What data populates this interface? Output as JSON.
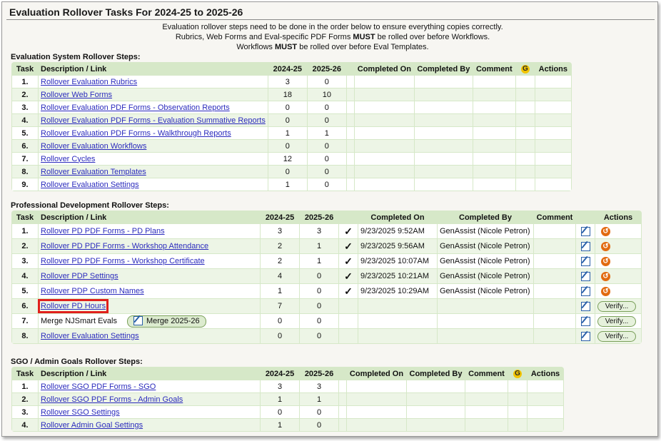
{
  "title": "Evaluation Rollover Tasks For 2024-25 to 2025-26",
  "intro": {
    "line1": "Evaluation rollover steps need to be done in the order below to ensure everything copies correctly.",
    "line2a": "Rubrics, Web Forms and Eval-specific PDF Forms ",
    "line2b": "MUST",
    "line2c": " be rolled over before Workflows.",
    "line3a": "Workflows ",
    "line3b": "MUST",
    "line3c": " be rolled over before Eval Templates."
  },
  "headers": {
    "task": "Task",
    "desc": "Description / Link",
    "y1": "2024-25",
    "y2": "2025-26",
    "completed_on": "Completed On",
    "completed_by": "Completed By",
    "comment": "Comment",
    "g": "G",
    "actions": "Actions"
  },
  "eval": {
    "title": "Evaluation System Rollover Steps:",
    "rows": [
      {
        "n": "1.",
        "label": "Rollover Evaluation Rubrics",
        "a": "3",
        "b": "0"
      },
      {
        "n": "2.",
        "label": "Rollover Web Forms",
        "a": "18",
        "b": "10"
      },
      {
        "n": "3.",
        "label": "Rollover Evaluation PDF Forms - Observation Reports",
        "a": "0",
        "b": "0"
      },
      {
        "n": "4.",
        "label": "Rollover Evaluation PDF Forms - Evaluation Summative Reports",
        "a": "0",
        "b": "0"
      },
      {
        "n": "5.",
        "label": "Rollover Evaluation PDF Forms - Walkthrough Reports",
        "a": "1",
        "b": "1"
      },
      {
        "n": "6.",
        "label": "Rollover Evaluation Workflows",
        "a": "0",
        "b": "0"
      },
      {
        "n": "7.",
        "label": "Rollover Cycles",
        "a": "12",
        "b": "0"
      },
      {
        "n": "8.",
        "label": "Rollover Evaluation Templates",
        "a": "0",
        "b": "0"
      },
      {
        "n": "9.",
        "label": "Rollover Evaluation Settings",
        "a": "1",
        "b": "0"
      }
    ]
  },
  "pd": {
    "title": "Professional Development Rollover Steps:",
    "check": "✓",
    "undo": "↺",
    "verify_label": "Verify...",
    "merge_label": "Merge 2025-26",
    "rows": [
      {
        "n": "1.",
        "label": "Rollover PD PDF Forms - PD Plans",
        "a": "3",
        "b": "3",
        "on": "9/23/2025 9:52AM",
        "by": "GenAssist (Nicole Petron)"
      },
      {
        "n": "2.",
        "label": "Rollover PD PDF Forms - Workshop Attendance",
        "a": "2",
        "b": "1",
        "on": "9/23/2025 9:56AM",
        "by": "GenAssist (Nicole Petron)"
      },
      {
        "n": "3.",
        "label": "Rollover PD PDF Forms - Workshop Certificate",
        "a": "2",
        "b": "1",
        "on": "9/23/2025 10:07AM",
        "by": "GenAssist (Nicole Petron)"
      },
      {
        "n": "4.",
        "label": "Rollover PDP Settings",
        "a": "4",
        "b": "0",
        "on": "9/23/2025 10:21AM",
        "by": "GenAssist (Nicole Petron)"
      },
      {
        "n": "5.",
        "label": "Rollover PDP Custom Names",
        "a": "1",
        "b": "0",
        "on": "9/23/2025 10:29AM",
        "by": "GenAssist (Nicole Petron)"
      },
      {
        "n": "6.",
        "label": "Rollover PD Hours",
        "a": "7",
        "b": "0"
      },
      {
        "n": "7.",
        "label": "Merge NJSmart Evals",
        "a": "0",
        "b": "0"
      },
      {
        "n": "8.",
        "label": "Rollover Evaluation Settings",
        "a": "0",
        "b": "0"
      }
    ]
  },
  "sgo": {
    "title": "SGO / Admin Goals Rollover Steps:",
    "rows": [
      {
        "n": "1.",
        "label": "Rollover SGO PDF Forms - SGO",
        "a": "3",
        "b": "3"
      },
      {
        "n": "2.",
        "label": "Rollover SGO PDF Forms - Admin Goals",
        "a": "1",
        "b": "1"
      },
      {
        "n": "3.",
        "label": "Rollover SGO Settings",
        "a": "0",
        "b": "0"
      },
      {
        "n": "4.",
        "label": "Rollover Admin Goal Settings",
        "a": "1",
        "b": "0"
      }
    ]
  }
}
